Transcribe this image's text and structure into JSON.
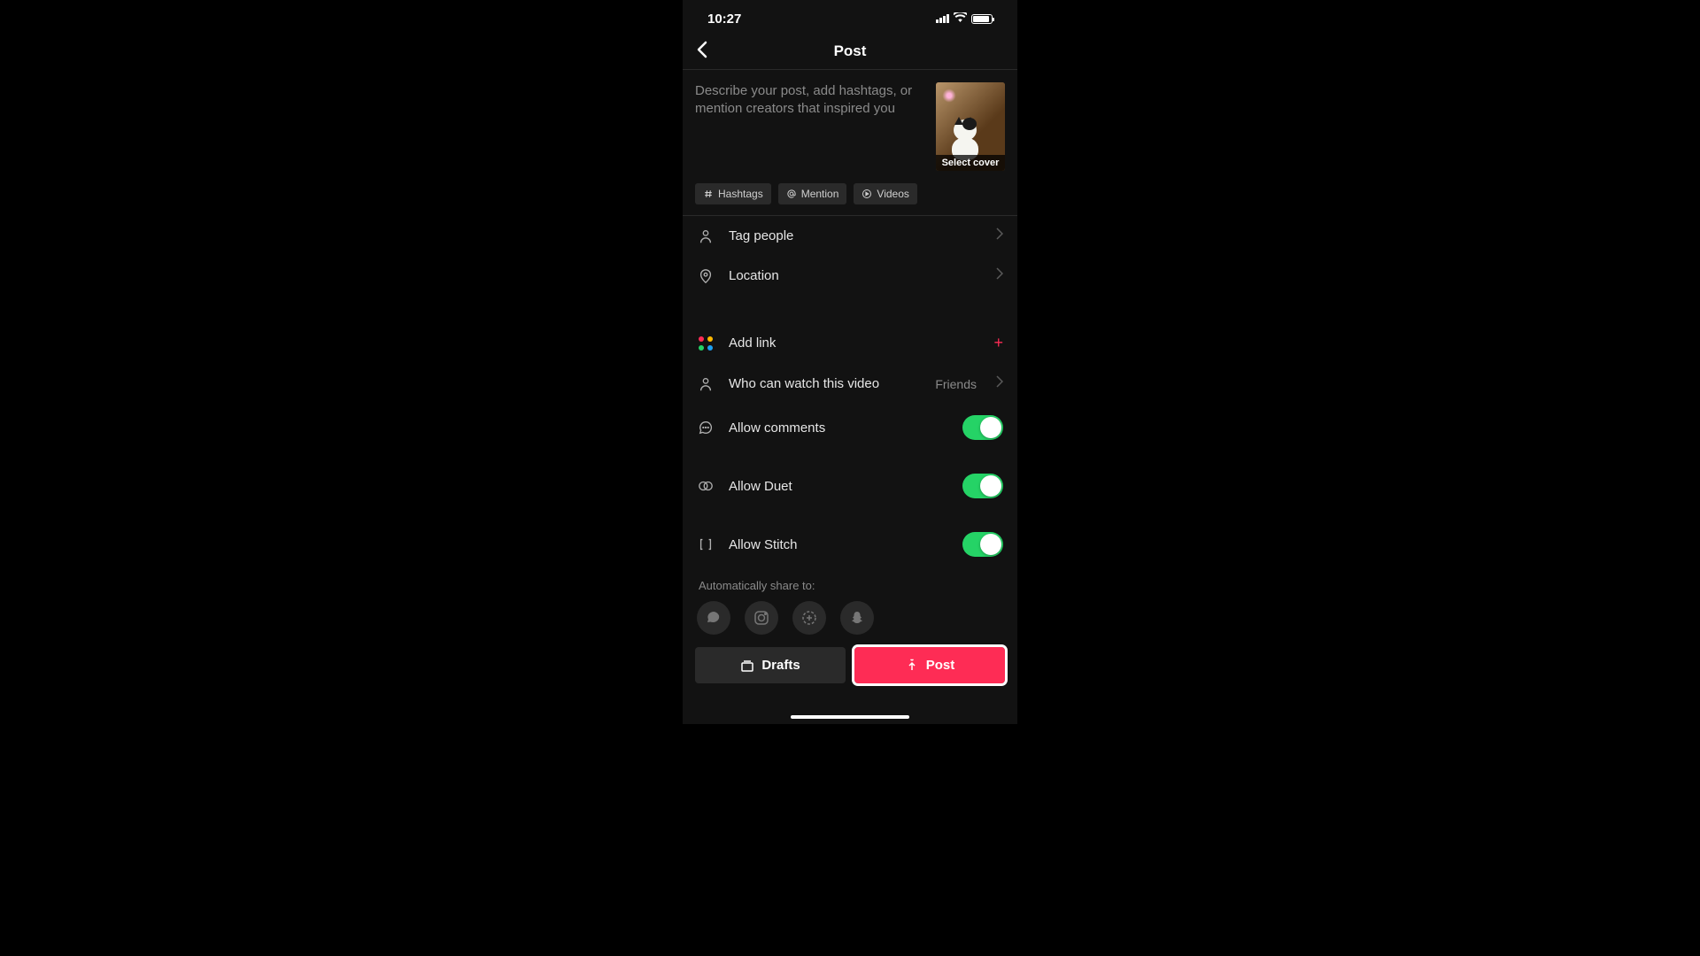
{
  "status": {
    "time": "10:27"
  },
  "nav": {
    "title": "Post"
  },
  "compose": {
    "placeholder": "Describe your post, add hashtags, or mention creators that inspired you",
    "cover_label": "Select cover"
  },
  "chips": {
    "hashtags": "Hashtags",
    "mention": "Mention",
    "videos": "Videos"
  },
  "rows": {
    "tag_people": "Tag people",
    "location": "Location",
    "add_link": "Add link",
    "privacy_label": "Who can watch this video",
    "privacy_value": "Friends",
    "allow_comments": "Allow comments",
    "allow_duet": "Allow Duet",
    "allow_stitch": "Allow Stitch"
  },
  "toggles": {
    "comments": true,
    "duet": true,
    "stitch": true
  },
  "share": {
    "label": "Automatically share to:"
  },
  "buttons": {
    "drafts": "Drafts",
    "post": "Post"
  },
  "colors": {
    "accent": "#fe2c55",
    "toggle_on": "#25d366"
  }
}
